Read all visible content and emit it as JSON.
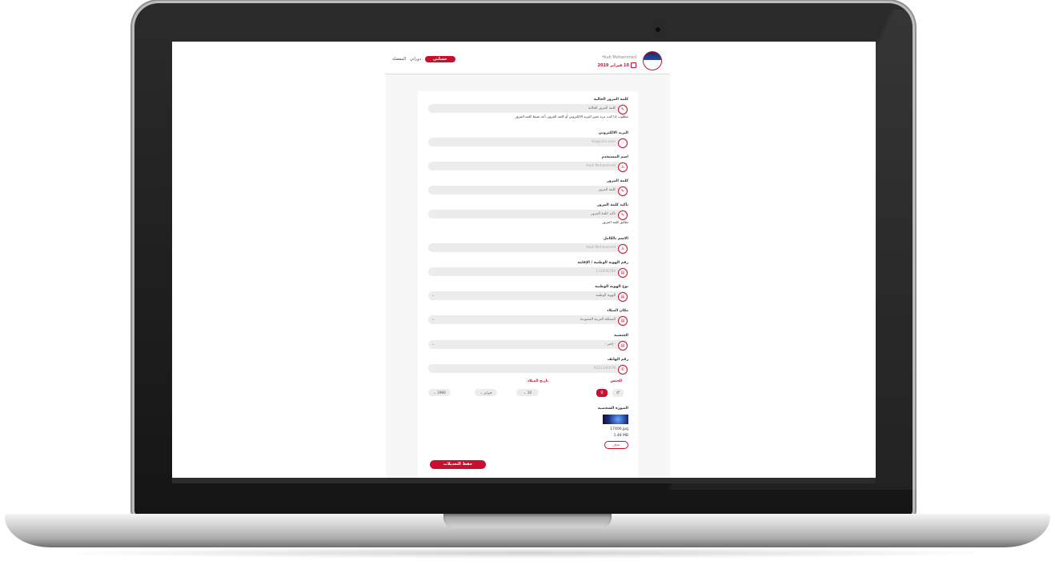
{
  "header": {
    "user_name": "Hudi Mohammed",
    "date": "10 فبراير 2019",
    "tabs": [
      {
        "label": "حسابي",
        "active": true
      },
      {
        "label": "دوراتي",
        "active": false
      },
      {
        "label": "المفضلة",
        "active": false
      }
    ]
  },
  "form": {
    "current_password": {
      "label": "كلمة المرور الحالية",
      "placeholder": "كلمة المرور الحالية",
      "hint": "مطلوب إذا كنت تريد تغيير البريد الالكتروني أو كلمة المرور، أعد ضبط كلمة المرور"
    },
    "email": {
      "label": "البريد الالكتروني",
      "placeholder": "Hu@core.com"
    },
    "username": {
      "label": "اسم المستخدم",
      "placeholder": "Hudi Mohammed"
    },
    "password": {
      "label": "كلمة المرور",
      "placeholder": "كلمة المرور"
    },
    "confirm_password": {
      "label": "تأكيد كلمة المرور",
      "placeholder": "تأكيد كلمة المرور",
      "hint": "تطابق كلمة المرور"
    },
    "full_name": {
      "label": "الاسم بالكامل",
      "placeholder": "Hudi Mohammed"
    },
    "national_id": {
      "label": "رقم الهوية الوطنية / الإقامة",
      "placeholder": "123456789"
    },
    "id_type": {
      "label": "نوع الهوية الوطنية",
      "value": "الهوية الوطنية"
    },
    "birth_place": {
      "label": "مكان الميلاد",
      "value": "المملكة العربية السعودية"
    },
    "nationality": {
      "label": "الجنسية",
      "value": "- إختر -"
    },
    "phone": {
      "label": "رقم الهاتف",
      "placeholder": "0512345678"
    },
    "gender": {
      "label": "الجنس"
    },
    "birth_date": {
      "label": "تاريخ الميلاد",
      "day": "10",
      "month": "فبراير",
      "year": "1980"
    },
    "photo": {
      "label": "الصورة الشخصية",
      "file_name": "17406.jpg",
      "file_size": "1.48 MB",
      "delete_label": "حذف"
    },
    "save_label": "حفظ التعديلات"
  },
  "colors": {
    "accent": "#c8102e",
    "input_bg": "#ececec"
  }
}
